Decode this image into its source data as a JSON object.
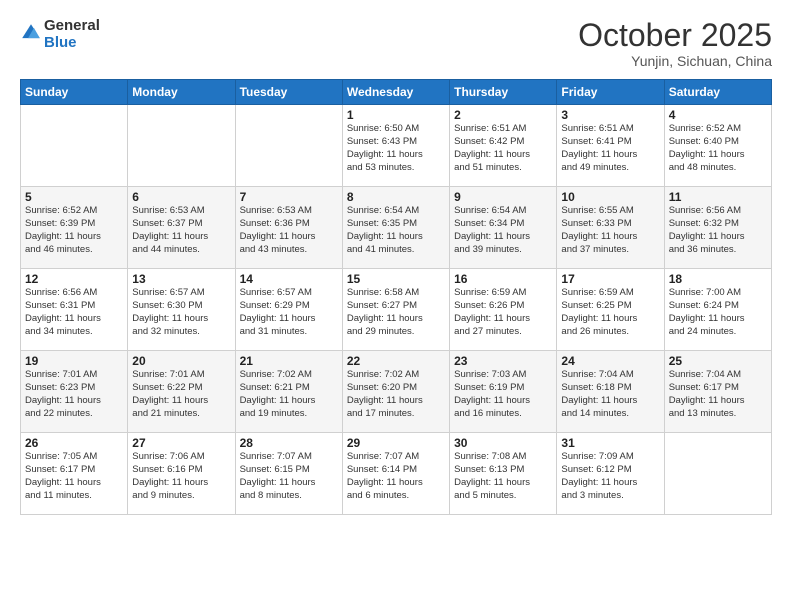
{
  "header": {
    "logo_line1": "General",
    "logo_line2": "Blue",
    "month": "October 2025",
    "location": "Yunjin, Sichuan, China"
  },
  "weekdays": [
    "Sunday",
    "Monday",
    "Tuesday",
    "Wednesday",
    "Thursday",
    "Friday",
    "Saturday"
  ],
  "weeks": [
    [
      {
        "day": "",
        "info": ""
      },
      {
        "day": "",
        "info": ""
      },
      {
        "day": "",
        "info": ""
      },
      {
        "day": "1",
        "info": "Sunrise: 6:50 AM\nSunset: 6:43 PM\nDaylight: 11 hours\nand 53 minutes."
      },
      {
        "day": "2",
        "info": "Sunrise: 6:51 AM\nSunset: 6:42 PM\nDaylight: 11 hours\nand 51 minutes."
      },
      {
        "day": "3",
        "info": "Sunrise: 6:51 AM\nSunset: 6:41 PM\nDaylight: 11 hours\nand 49 minutes."
      },
      {
        "day": "4",
        "info": "Sunrise: 6:52 AM\nSunset: 6:40 PM\nDaylight: 11 hours\nand 48 minutes."
      }
    ],
    [
      {
        "day": "5",
        "info": "Sunrise: 6:52 AM\nSunset: 6:39 PM\nDaylight: 11 hours\nand 46 minutes."
      },
      {
        "day": "6",
        "info": "Sunrise: 6:53 AM\nSunset: 6:37 PM\nDaylight: 11 hours\nand 44 minutes."
      },
      {
        "day": "7",
        "info": "Sunrise: 6:53 AM\nSunset: 6:36 PM\nDaylight: 11 hours\nand 43 minutes."
      },
      {
        "day": "8",
        "info": "Sunrise: 6:54 AM\nSunset: 6:35 PM\nDaylight: 11 hours\nand 41 minutes."
      },
      {
        "day": "9",
        "info": "Sunrise: 6:54 AM\nSunset: 6:34 PM\nDaylight: 11 hours\nand 39 minutes."
      },
      {
        "day": "10",
        "info": "Sunrise: 6:55 AM\nSunset: 6:33 PM\nDaylight: 11 hours\nand 37 minutes."
      },
      {
        "day": "11",
        "info": "Sunrise: 6:56 AM\nSunset: 6:32 PM\nDaylight: 11 hours\nand 36 minutes."
      }
    ],
    [
      {
        "day": "12",
        "info": "Sunrise: 6:56 AM\nSunset: 6:31 PM\nDaylight: 11 hours\nand 34 minutes."
      },
      {
        "day": "13",
        "info": "Sunrise: 6:57 AM\nSunset: 6:30 PM\nDaylight: 11 hours\nand 32 minutes."
      },
      {
        "day": "14",
        "info": "Sunrise: 6:57 AM\nSunset: 6:29 PM\nDaylight: 11 hours\nand 31 minutes."
      },
      {
        "day": "15",
        "info": "Sunrise: 6:58 AM\nSunset: 6:27 PM\nDaylight: 11 hours\nand 29 minutes."
      },
      {
        "day": "16",
        "info": "Sunrise: 6:59 AM\nSunset: 6:26 PM\nDaylight: 11 hours\nand 27 minutes."
      },
      {
        "day": "17",
        "info": "Sunrise: 6:59 AM\nSunset: 6:25 PM\nDaylight: 11 hours\nand 26 minutes."
      },
      {
        "day": "18",
        "info": "Sunrise: 7:00 AM\nSunset: 6:24 PM\nDaylight: 11 hours\nand 24 minutes."
      }
    ],
    [
      {
        "day": "19",
        "info": "Sunrise: 7:01 AM\nSunset: 6:23 PM\nDaylight: 11 hours\nand 22 minutes."
      },
      {
        "day": "20",
        "info": "Sunrise: 7:01 AM\nSunset: 6:22 PM\nDaylight: 11 hours\nand 21 minutes."
      },
      {
        "day": "21",
        "info": "Sunrise: 7:02 AM\nSunset: 6:21 PM\nDaylight: 11 hours\nand 19 minutes."
      },
      {
        "day": "22",
        "info": "Sunrise: 7:02 AM\nSunset: 6:20 PM\nDaylight: 11 hours\nand 17 minutes."
      },
      {
        "day": "23",
        "info": "Sunrise: 7:03 AM\nSunset: 6:19 PM\nDaylight: 11 hours\nand 16 minutes."
      },
      {
        "day": "24",
        "info": "Sunrise: 7:04 AM\nSunset: 6:18 PM\nDaylight: 11 hours\nand 14 minutes."
      },
      {
        "day": "25",
        "info": "Sunrise: 7:04 AM\nSunset: 6:17 PM\nDaylight: 11 hours\nand 13 minutes."
      }
    ],
    [
      {
        "day": "26",
        "info": "Sunrise: 7:05 AM\nSunset: 6:17 PM\nDaylight: 11 hours\nand 11 minutes."
      },
      {
        "day": "27",
        "info": "Sunrise: 7:06 AM\nSunset: 6:16 PM\nDaylight: 11 hours\nand 9 minutes."
      },
      {
        "day": "28",
        "info": "Sunrise: 7:07 AM\nSunset: 6:15 PM\nDaylight: 11 hours\nand 8 minutes."
      },
      {
        "day": "29",
        "info": "Sunrise: 7:07 AM\nSunset: 6:14 PM\nDaylight: 11 hours\nand 6 minutes."
      },
      {
        "day": "30",
        "info": "Sunrise: 7:08 AM\nSunset: 6:13 PM\nDaylight: 11 hours\nand 5 minutes."
      },
      {
        "day": "31",
        "info": "Sunrise: 7:09 AM\nSunset: 6:12 PM\nDaylight: 11 hours\nand 3 minutes."
      },
      {
        "day": "",
        "info": ""
      }
    ]
  ]
}
